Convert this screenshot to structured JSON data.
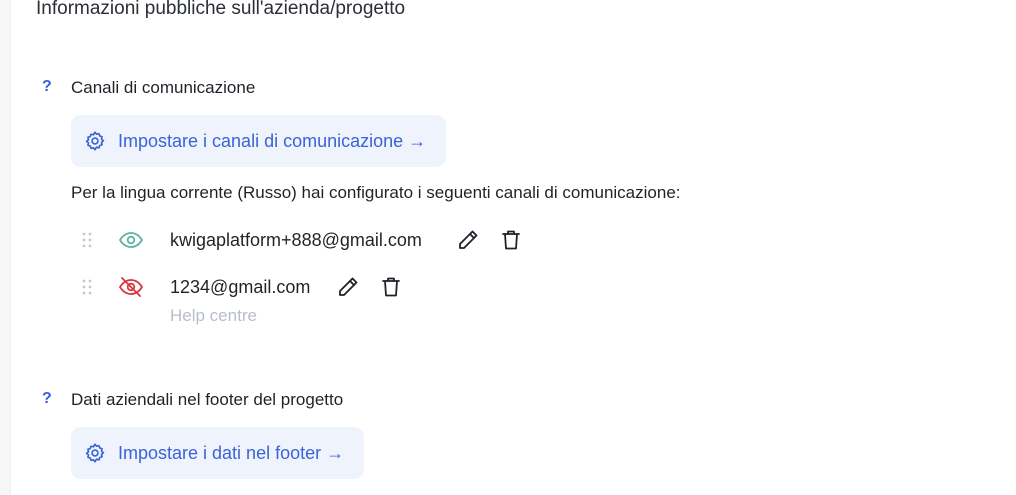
{
  "page": {
    "title": "Informazioni pubbliche sull'azienda/progetto"
  },
  "sections": [
    {
      "help_mark": "?",
      "title": "Canali di comunicazione",
      "button_label": "Impostare i canali di comunicazione →",
      "info_text": "Per la lingua corrente (Russo) hai configurato i seguenti canali di comunicazione:",
      "channels": [
        {
          "value": "kwigaplatform+888@gmail.com",
          "visible": true,
          "sublabel": ""
        },
        {
          "value": "1234@gmail.com",
          "visible": false,
          "sublabel": "Help centre"
        }
      ]
    },
    {
      "help_mark": "?",
      "title": "Dati aziendali nel footer del progetto",
      "button_label": "Impostare i dati nel footer →"
    }
  ],
  "icons": {
    "help": "question-mark",
    "settings": "gear-icon",
    "drag": "drag-handle-icon",
    "visible": "eye-icon",
    "hidden": "eye-off-icon",
    "edit": "pencil-icon",
    "delete": "trash-icon"
  },
  "colors": {
    "accent": "#3b63d9",
    "button_bg": "#eef3fc",
    "visible_icon": "#5fb3a1",
    "hidden_icon": "#d9373f",
    "muted_text": "#b8bec8"
  }
}
